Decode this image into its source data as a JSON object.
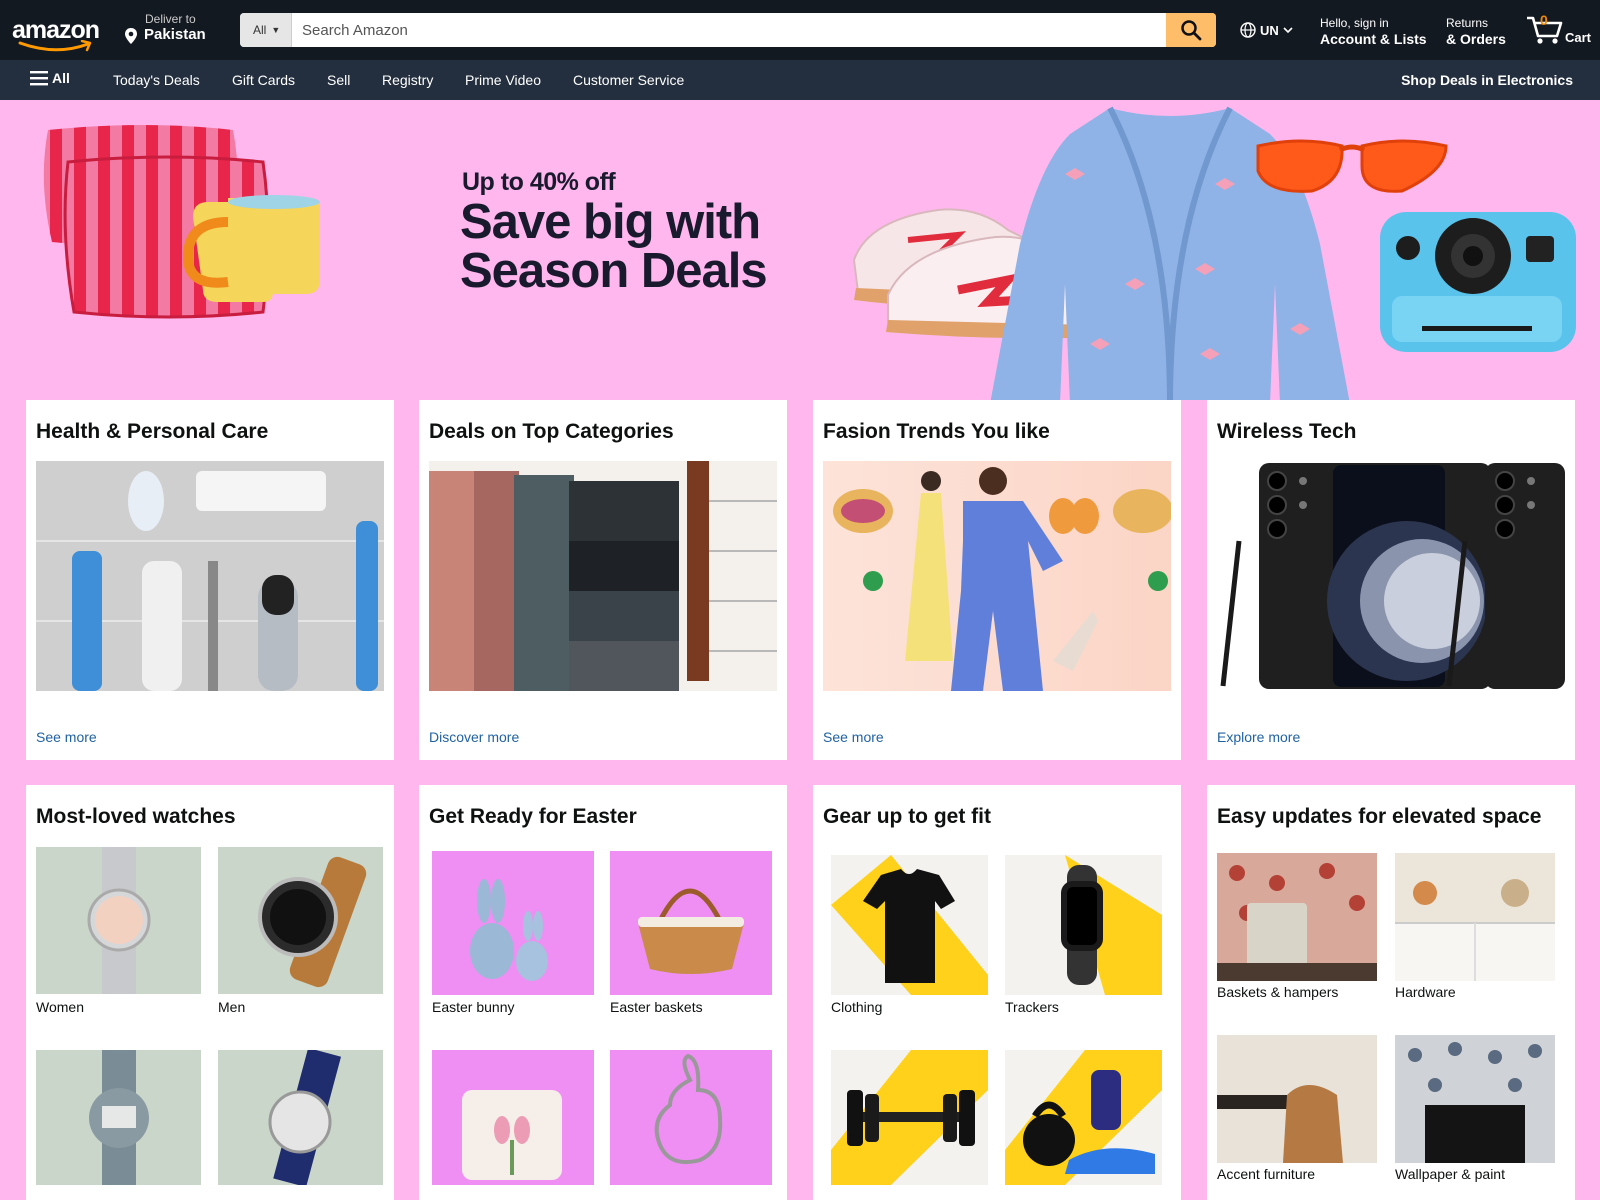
{
  "header": {
    "logo_text": "amazon",
    "deliver_line1": "Deliver to",
    "deliver_line2": "Pakistan",
    "search_category": "All",
    "search_placeholder": "Search Amazon",
    "language": "UN",
    "account_line1": "Hello, sign in",
    "account_line2": "Account & Lists",
    "returns_line1": "Returns",
    "returns_line2": "& Orders",
    "cart_count": "0",
    "cart_label": "Cart"
  },
  "subnav": {
    "all_label": "All",
    "items": [
      "Today's Deals",
      "Gift Cards",
      "Sell",
      "Registry",
      "Prime Video",
      "Customer Service"
    ],
    "right_label": "Shop Deals in Electronics"
  },
  "hero": {
    "subheadline": "Up to 40% off",
    "headline": "Save big with\nSeason Deals"
  },
  "cards_row1": [
    {
      "title": "Health & Personal Care",
      "link": "See more"
    },
    {
      "title": "Deals on Top Categories",
      "link": "Discover more"
    },
    {
      "title": "Fasion Trends You like",
      "link": "See more"
    },
    {
      "title": "Wireless Tech",
      "link": "Explore more"
    }
  ],
  "cards_row2": [
    {
      "title": "Most-loved watches",
      "items": [
        "Women",
        "Men",
        "",
        ""
      ]
    },
    {
      "title": "Get Ready for Easter",
      "items": [
        "Easter bunny",
        "Easter baskets",
        "",
        ""
      ]
    },
    {
      "title": "Gear up to get fit",
      "items": [
        "Clothing",
        "Trackers",
        "",
        ""
      ]
    },
    {
      "title": "Easy updates for elevated space",
      "items": [
        "Baskets & hampers",
        "Hardware",
        "Accent furniture",
        "Wallpaper & paint"
      ]
    }
  ],
  "colors": {
    "nav_bg": "#131921",
    "subnav_bg": "#232f3e",
    "search_button": "#febd69",
    "hero_bg": "#ffb7ee",
    "link": "#2162a1"
  },
  "icons": [
    "location-pin-icon",
    "search-icon",
    "globe-icon",
    "chevron-down-icon",
    "cart-icon",
    "hamburger-menu-icon"
  ]
}
